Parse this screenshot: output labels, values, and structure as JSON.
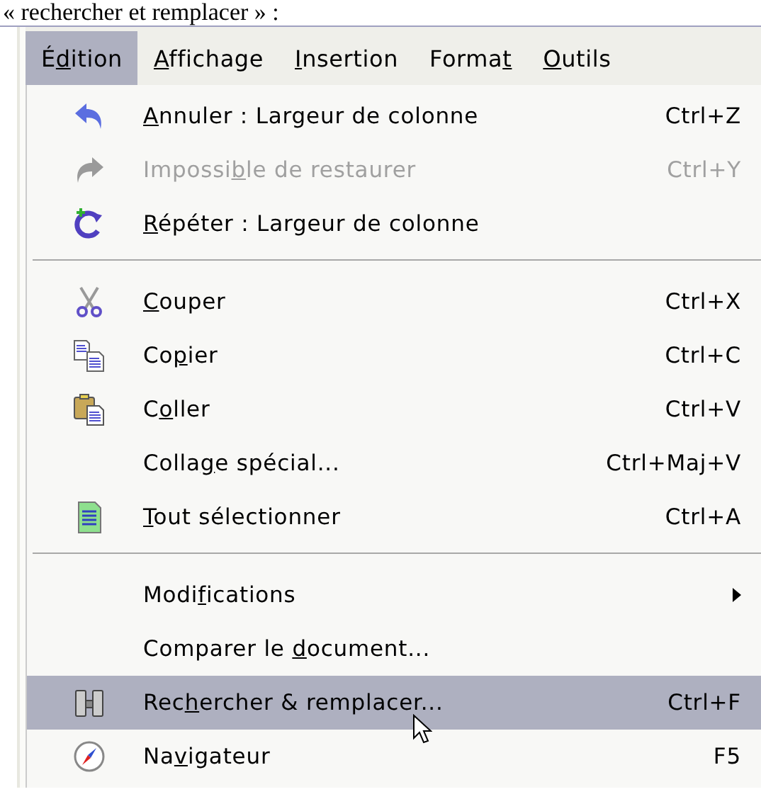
{
  "caption": "« rechercher et remplacer » :",
  "menubar": [
    {
      "label": {
        "pre": "É",
        "key": "d",
        "post": "ition"
      },
      "selected": true
    },
    {
      "label": {
        "key": "A",
        "post": "ffichage"
      },
      "selected": false
    },
    {
      "label": {
        "key": "I",
        "post": "nsertion"
      },
      "selected": false
    },
    {
      "label": {
        "pre": "Forma",
        "key": "t"
      },
      "selected": false
    },
    {
      "label": {
        "key": "O",
        "post": "utils"
      },
      "selected": false
    }
  ],
  "menu": [
    {
      "kind": "item",
      "label": {
        "key": "A",
        "post": "nnuler : Largeur de colonne"
      },
      "shortcut": "Ctrl+Z",
      "disabled": false,
      "selected": false
    },
    {
      "kind": "item",
      "label": {
        "pre": "Impossi",
        "key": "b",
        "post": "le de restaurer"
      },
      "shortcut": "Ctrl+Y",
      "disabled": true,
      "selected": false
    },
    {
      "kind": "item",
      "label": {
        "key": "R",
        "post": "épéter : Largeur de colonne"
      },
      "disabled": false,
      "selected": false
    },
    {
      "kind": "separator"
    },
    {
      "kind": "item",
      "label": {
        "key": "C",
        "post": "ouper"
      },
      "shortcut": "Ctrl+X",
      "disabled": false,
      "selected": false
    },
    {
      "kind": "item",
      "label": {
        "pre": "Co",
        "key": "p",
        "post": "ier"
      },
      "shortcut": "Ctrl+C",
      "disabled": false,
      "selected": false
    },
    {
      "kind": "item",
      "label": {
        "pre": "C",
        "key": "o",
        "post": "ller"
      },
      "shortcut": "Ctrl+V",
      "disabled": false,
      "selected": false
    },
    {
      "kind": "item",
      "label": {
        "pre": "Colla",
        "key": "g",
        "post": "e spécial..."
      },
      "shortcut": "Ctrl+Maj+V",
      "disabled": false,
      "selected": false
    },
    {
      "kind": "item",
      "label": {
        "key": "T",
        "post": "out sélectionner"
      },
      "shortcut": "Ctrl+A",
      "disabled": false,
      "selected": false
    },
    {
      "kind": "separator"
    },
    {
      "kind": "submenu",
      "label": {
        "pre": "Modi",
        "key": "f",
        "post": "ications"
      },
      "disabled": false,
      "selected": false
    },
    {
      "kind": "item",
      "label": {
        "pre": "Comparer le ",
        "key": "d",
        "post": "ocument..."
      },
      "disabled": false,
      "selected": false
    },
    {
      "kind": "item",
      "label": {
        "pre": "Rec",
        "key": "h",
        "post": "ercher & remplacer..."
      },
      "shortcut": "Ctrl+F",
      "disabled": false,
      "selected": true
    },
    {
      "kind": "item",
      "label": {
        "pre": "Na",
        "key": "v",
        "post": "igateur"
      },
      "shortcut": "F5",
      "disabled": false,
      "selected": false
    }
  ]
}
